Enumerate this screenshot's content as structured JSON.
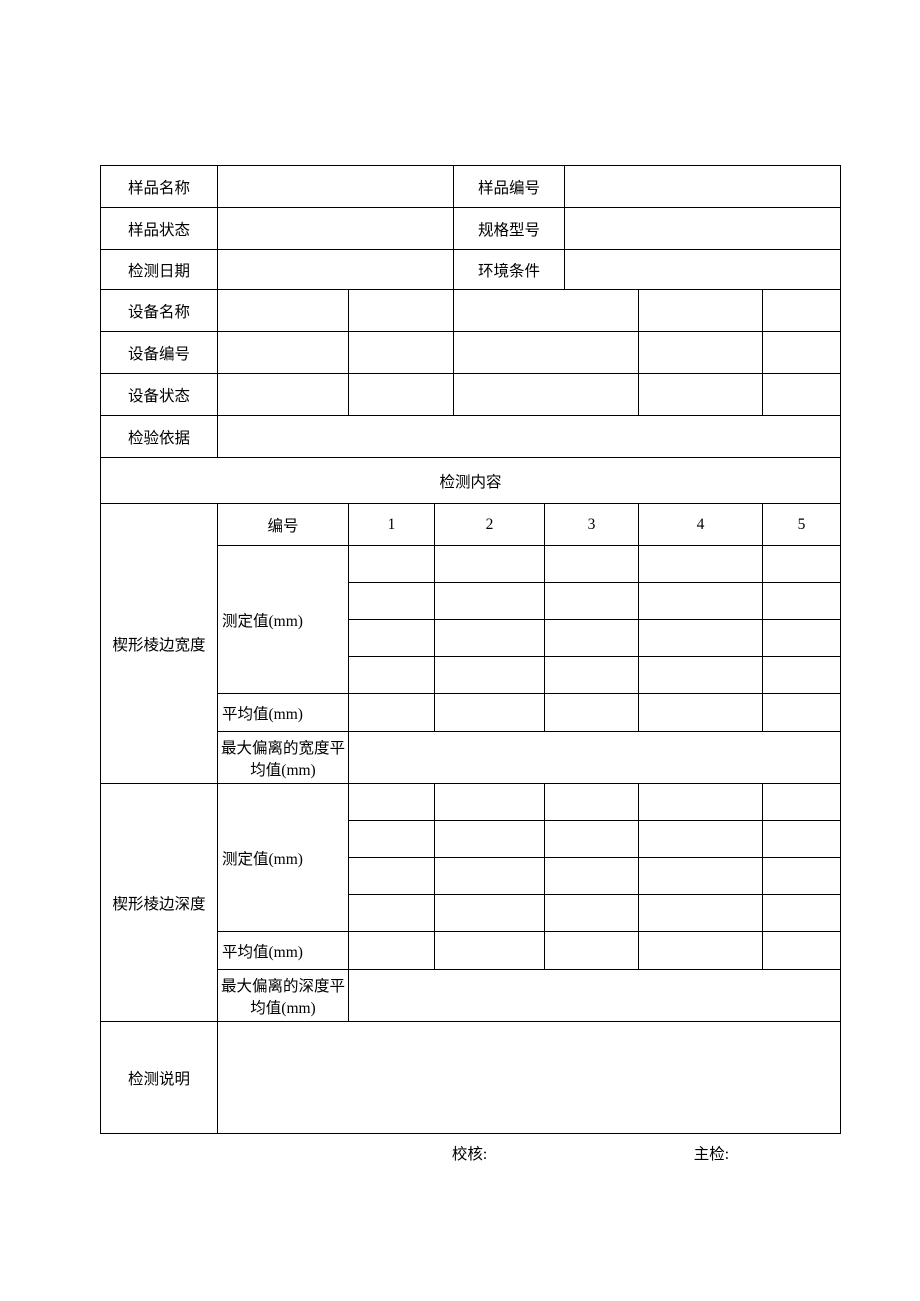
{
  "header": {
    "r1c1": "样品名称",
    "r1c3": "样品编号",
    "r2c1": "样品状态",
    "r2c3": "规格型号",
    "r3c1": "检测日期",
    "r3c3": "环境条件",
    "r4c1": "设备名称",
    "r5c1": "设备编号",
    "r6c1": "设备状态",
    "r7c1": "检验依据"
  },
  "section_title": "检测内容",
  "cols": {
    "numbering": "编号",
    "n1": "1",
    "n2": "2",
    "n3": "3",
    "n4": "4",
    "n5": "5"
  },
  "groupA": {
    "title": "楔形棱边宽度",
    "measured": "测定值(mm)",
    "avg": "平均值(mm)",
    "max": "最大偏离的宽度平均值(mm)"
  },
  "groupB": {
    "title": "楔形棱边深度",
    "measured": "测定值(mm)",
    "avg": "平均值(mm)",
    "max": "最大偏离的深度平均值(mm)"
  },
  "note_label": "检测说明",
  "footer": {
    "left": "校核:",
    "right": "主检:"
  }
}
